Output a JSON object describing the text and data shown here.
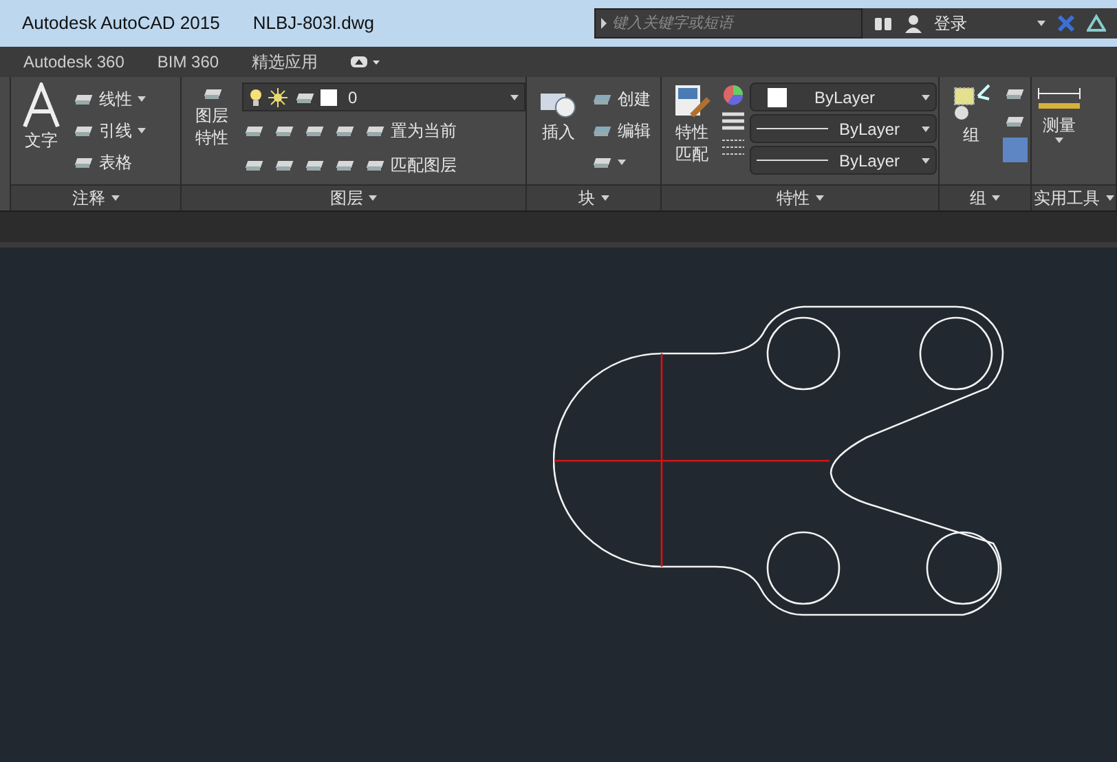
{
  "window": {
    "app_title": "Autodesk AutoCAD 2015",
    "file_name": "NLBJ-803l.dwg"
  },
  "search": {
    "placeholder": "键入关键字或短语"
  },
  "account": {
    "label": "登录"
  },
  "ribbon_tabs": [
    "Autodesk 360",
    "BIM 360",
    "精选应用"
  ],
  "panels": {
    "annotation": {
      "title": "注释",
      "text_tool": "文字",
      "tools": [
        "线性",
        "引线",
        "表格"
      ]
    },
    "layers": {
      "title": "图层",
      "properties_tool": [
        "图层",
        "特性"
      ],
      "current_layer": "0",
      "actions": [
        "置为当前",
        "匹配图层"
      ]
    },
    "block": {
      "title": "块",
      "insert_tool": "插入",
      "tools": [
        "创建",
        "编辑"
      ]
    },
    "properties": {
      "title": "特性",
      "match_tool": [
        "特性",
        "匹配"
      ],
      "dropdowns": [
        "ByLayer",
        "ByLayer",
        "ByLayer"
      ]
    },
    "group": {
      "title": "组",
      "group_tool": "组"
    },
    "utilities": {
      "title": "实用工具",
      "measure_tool": "测量"
    }
  }
}
